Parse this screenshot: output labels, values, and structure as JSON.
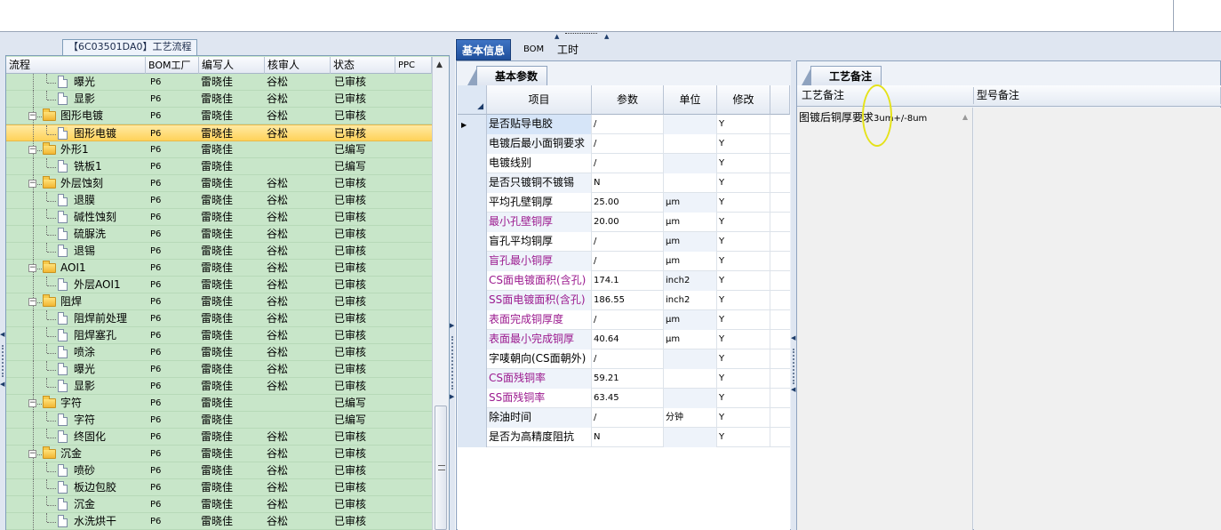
{
  "tree": {
    "title": "【6C03501DA0】工艺流程",
    "columns": [
      "流程",
      "BOM工厂",
      "编写人",
      "核审人",
      "状态",
      "PPC"
    ],
    "rows": [
      {
        "level": 2,
        "type": "file",
        "name": "曝光",
        "factory": "P6",
        "writer": "雷晓佳",
        "reviewer": "谷松",
        "status": "已审核"
      },
      {
        "level": 2,
        "type": "file",
        "name": "显影",
        "factory": "P6",
        "writer": "雷晓佳",
        "reviewer": "谷松",
        "status": "已审核"
      },
      {
        "level": 1,
        "type": "folder",
        "name": "图形电镀",
        "factory": "P6",
        "writer": "雷晓佳",
        "reviewer": "谷松",
        "status": "已审核"
      },
      {
        "level": 2,
        "type": "file",
        "name": "图形电镀",
        "factory": "P6",
        "writer": "雷晓佳",
        "reviewer": "谷松",
        "status": "已审核",
        "selected": true
      },
      {
        "level": 1,
        "type": "folder",
        "name": "外形1",
        "factory": "P6",
        "writer": "雷晓佳",
        "reviewer": "",
        "status": "已编写"
      },
      {
        "level": 2,
        "type": "file",
        "name": "铣板1",
        "factory": "P6",
        "writer": "雷晓佳",
        "reviewer": "",
        "status": "已编写"
      },
      {
        "level": 1,
        "type": "folder",
        "name": "外层蚀刻",
        "factory": "P6",
        "writer": "雷晓佳",
        "reviewer": "谷松",
        "status": "已审核"
      },
      {
        "level": 2,
        "type": "file",
        "name": "退膜",
        "factory": "P6",
        "writer": "雷晓佳",
        "reviewer": "谷松",
        "status": "已审核"
      },
      {
        "level": 2,
        "type": "file",
        "name": "碱性蚀刻",
        "factory": "P6",
        "writer": "雷晓佳",
        "reviewer": "谷松",
        "status": "已审核"
      },
      {
        "level": 2,
        "type": "file",
        "name": "硫脲洗",
        "factory": "P6",
        "writer": "雷晓佳",
        "reviewer": "谷松",
        "status": "已审核"
      },
      {
        "level": 2,
        "type": "file",
        "name": "退锡",
        "factory": "P6",
        "writer": "雷晓佳",
        "reviewer": "谷松",
        "status": "已审核"
      },
      {
        "level": 1,
        "type": "folder",
        "name": "AOI1",
        "factory": "P6",
        "writer": "雷晓佳",
        "reviewer": "谷松",
        "status": "已审核"
      },
      {
        "level": 2,
        "type": "file",
        "name": "外层AOI1",
        "factory": "P6",
        "writer": "雷晓佳",
        "reviewer": "谷松",
        "status": "已审核"
      },
      {
        "level": 1,
        "type": "folder",
        "name": "阻焊",
        "factory": "P6",
        "writer": "雷晓佳",
        "reviewer": "谷松",
        "status": "已审核"
      },
      {
        "level": 2,
        "type": "file",
        "name": "阻焊前处理",
        "factory": "P6",
        "writer": "雷晓佳",
        "reviewer": "谷松",
        "status": "已审核"
      },
      {
        "level": 2,
        "type": "file",
        "name": "阻焊塞孔",
        "factory": "P6",
        "writer": "雷晓佳",
        "reviewer": "谷松",
        "status": "已审核"
      },
      {
        "level": 2,
        "type": "file",
        "name": "喷涂",
        "factory": "P6",
        "writer": "雷晓佳",
        "reviewer": "谷松",
        "status": "已审核"
      },
      {
        "level": 2,
        "type": "file",
        "name": "曝光",
        "factory": "P6",
        "writer": "雷晓佳",
        "reviewer": "谷松",
        "status": "已审核"
      },
      {
        "level": 2,
        "type": "file",
        "name": "显影",
        "factory": "P6",
        "writer": "雷晓佳",
        "reviewer": "谷松",
        "status": "已审核"
      },
      {
        "level": 1,
        "type": "folder",
        "name": "字符",
        "factory": "P6",
        "writer": "雷晓佳",
        "reviewer": "",
        "status": "已编写"
      },
      {
        "level": 2,
        "type": "file",
        "name": "字符",
        "factory": "P6",
        "writer": "雷晓佳",
        "reviewer": "",
        "status": "已编写"
      },
      {
        "level": 2,
        "type": "file",
        "name": "终固化",
        "factory": "P6",
        "writer": "雷晓佳",
        "reviewer": "谷松",
        "status": "已审核"
      },
      {
        "level": 1,
        "type": "folder",
        "name": "沉金",
        "factory": "P6",
        "writer": "雷晓佳",
        "reviewer": "谷松",
        "status": "已审核"
      },
      {
        "level": 2,
        "type": "file",
        "name": "喷砂",
        "factory": "P6",
        "writer": "雷晓佳",
        "reviewer": "谷松",
        "status": "已审核"
      },
      {
        "level": 2,
        "type": "file",
        "name": "板边包胶",
        "factory": "P6",
        "writer": "雷晓佳",
        "reviewer": "谷松",
        "status": "已审核"
      },
      {
        "level": 2,
        "type": "file",
        "name": "沉金",
        "factory": "P6",
        "writer": "雷晓佳",
        "reviewer": "谷松",
        "status": "已审核"
      },
      {
        "level": 2,
        "type": "file",
        "name": "水洗烘干",
        "factory": "P6",
        "writer": "雷晓佳",
        "reviewer": "谷松",
        "status": "已审核"
      }
    ]
  },
  "tabs": [
    {
      "label": "基本信息",
      "active": true
    },
    {
      "label": "BOM",
      "active": false
    },
    {
      "label": "工时",
      "active": false
    }
  ],
  "basic": {
    "subtab": "基本参数",
    "columns": [
      "项目",
      "参数",
      "单位",
      "修改"
    ],
    "rows": [
      {
        "item": "是否贴导电胶",
        "value": "/",
        "unit": "",
        "mod": "Y",
        "magenta": false,
        "current": true
      },
      {
        "item": "电镀后最小面铜要求",
        "value": "/",
        "unit": "",
        "mod": "Y",
        "magenta": false
      },
      {
        "item": "电镀线别",
        "value": "/",
        "unit": "",
        "mod": "Y",
        "magenta": false
      },
      {
        "item": "是否只镀铜不镀锡",
        "value": "N",
        "unit": "",
        "mod": "Y",
        "magenta": false
      },
      {
        "item": "平均孔壁铜厚",
        "value": "25.00",
        "unit": "μm",
        "mod": "Y",
        "magenta": false
      },
      {
        "item": "最小孔壁铜厚",
        "value": "20.00",
        "unit": "μm",
        "mod": "Y",
        "magenta": true
      },
      {
        "item": "盲孔平均铜厚",
        "value": "/",
        "unit": "μm",
        "mod": "Y",
        "magenta": false
      },
      {
        "item": "盲孔最小铜厚",
        "value": "/",
        "unit": "μm",
        "mod": "Y",
        "magenta": true
      },
      {
        "item": "CS面电镀面积(含孔)",
        "value": "174.1",
        "unit": "inch2",
        "mod": "Y",
        "magenta": true
      },
      {
        "item": "SS面电镀面积(含孔)",
        "value": "186.55",
        "unit": "inch2",
        "mod": "Y",
        "magenta": true
      },
      {
        "item": "表面完成铜厚度",
        "value": "/",
        "unit": "μm",
        "mod": "Y",
        "magenta": true
      },
      {
        "item": "表面最小完成铜厚",
        "value": "40.64",
        "unit": "μm",
        "mod": "Y",
        "magenta": true
      },
      {
        "item": "字唛朝向(CS面朝外)",
        "value": "/",
        "unit": "",
        "mod": "Y",
        "magenta": false
      },
      {
        "item": "CS面残铜率",
        "value": "59.21",
        "unit": "",
        "mod": "Y",
        "magenta": true
      },
      {
        "item": "SS面残铜率",
        "value": "63.45",
        "unit": "",
        "mod": "Y",
        "magenta": true
      },
      {
        "item": "除油时间",
        "value": "/",
        "unit": "分钟",
        "mod": "Y",
        "magenta": false
      },
      {
        "item": "是否为高精度阻抗",
        "value": "N",
        "unit": "",
        "mod": "Y",
        "magenta": false
      }
    ]
  },
  "notes": {
    "subtab": "工艺备注",
    "col1_header": "工艺备注",
    "col2_header": "型号备注",
    "process_note_prefix": "图镀后铜厚要求",
    "process_note_value": "3um",
    "process_note_rest": "+/-8um"
  },
  "colors": {
    "tree_bg": "#c8e6c9",
    "selection": "#ffd25a",
    "tab_active": "#2a5caa",
    "magenta_text": "#9b1a8f",
    "highlight_circle": "#e5e21a"
  }
}
